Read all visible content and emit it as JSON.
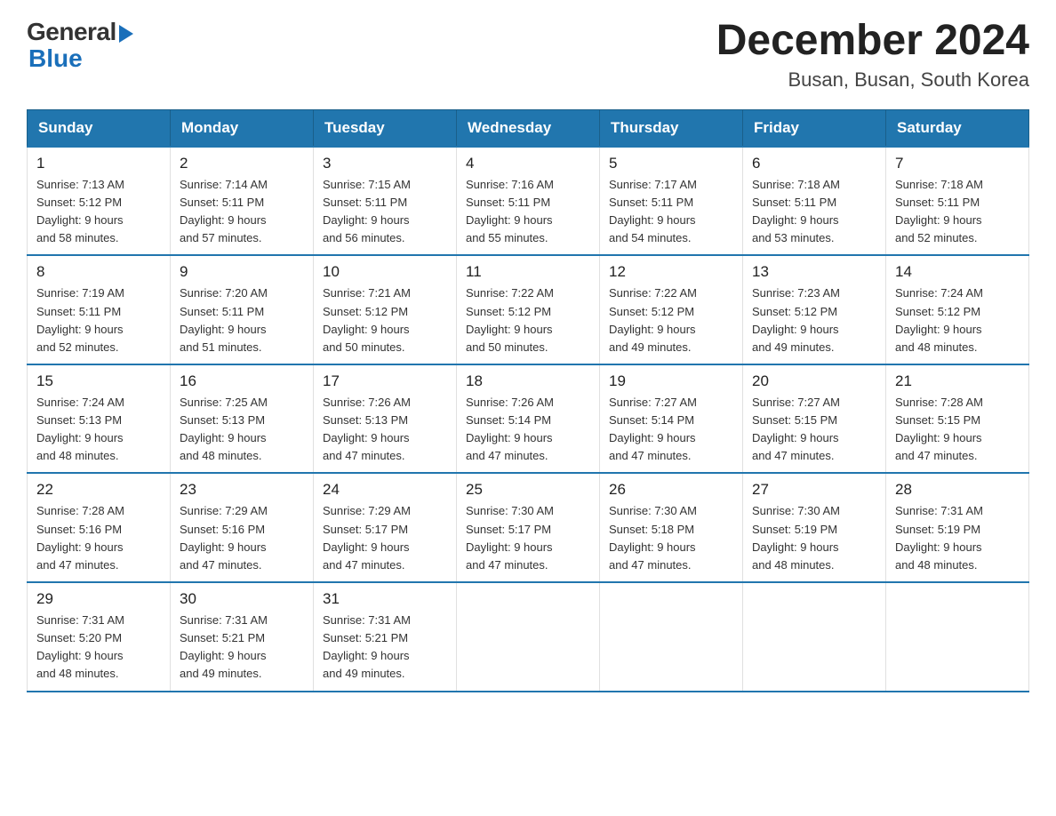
{
  "logo": {
    "general": "General",
    "blue": "Blue"
  },
  "title": {
    "month_year": "December 2024",
    "location": "Busan, Busan, South Korea"
  },
  "days_of_week": [
    "Sunday",
    "Monday",
    "Tuesday",
    "Wednesday",
    "Thursday",
    "Friday",
    "Saturday"
  ],
  "weeks": [
    [
      {
        "day": "1",
        "sunrise": "7:13 AM",
        "sunset": "5:12 PM",
        "daylight": "9 hours and 58 minutes."
      },
      {
        "day": "2",
        "sunrise": "7:14 AM",
        "sunset": "5:11 PM",
        "daylight": "9 hours and 57 minutes."
      },
      {
        "day": "3",
        "sunrise": "7:15 AM",
        "sunset": "5:11 PM",
        "daylight": "9 hours and 56 minutes."
      },
      {
        "day": "4",
        "sunrise": "7:16 AM",
        "sunset": "5:11 PM",
        "daylight": "9 hours and 55 minutes."
      },
      {
        "day": "5",
        "sunrise": "7:17 AM",
        "sunset": "5:11 PM",
        "daylight": "9 hours and 54 minutes."
      },
      {
        "day": "6",
        "sunrise": "7:18 AM",
        "sunset": "5:11 PM",
        "daylight": "9 hours and 53 minutes."
      },
      {
        "day": "7",
        "sunrise": "7:18 AM",
        "sunset": "5:11 PM",
        "daylight": "9 hours and 52 minutes."
      }
    ],
    [
      {
        "day": "8",
        "sunrise": "7:19 AM",
        "sunset": "5:11 PM",
        "daylight": "9 hours and 52 minutes."
      },
      {
        "day": "9",
        "sunrise": "7:20 AM",
        "sunset": "5:11 PM",
        "daylight": "9 hours and 51 minutes."
      },
      {
        "day": "10",
        "sunrise": "7:21 AM",
        "sunset": "5:12 PM",
        "daylight": "9 hours and 50 minutes."
      },
      {
        "day": "11",
        "sunrise": "7:22 AM",
        "sunset": "5:12 PM",
        "daylight": "9 hours and 50 minutes."
      },
      {
        "day": "12",
        "sunrise": "7:22 AM",
        "sunset": "5:12 PM",
        "daylight": "9 hours and 49 minutes."
      },
      {
        "day": "13",
        "sunrise": "7:23 AM",
        "sunset": "5:12 PM",
        "daylight": "9 hours and 49 minutes."
      },
      {
        "day": "14",
        "sunrise": "7:24 AM",
        "sunset": "5:12 PM",
        "daylight": "9 hours and 48 minutes."
      }
    ],
    [
      {
        "day": "15",
        "sunrise": "7:24 AM",
        "sunset": "5:13 PM",
        "daylight": "9 hours and 48 minutes."
      },
      {
        "day": "16",
        "sunrise": "7:25 AM",
        "sunset": "5:13 PM",
        "daylight": "9 hours and 48 minutes."
      },
      {
        "day": "17",
        "sunrise": "7:26 AM",
        "sunset": "5:13 PM",
        "daylight": "9 hours and 47 minutes."
      },
      {
        "day": "18",
        "sunrise": "7:26 AM",
        "sunset": "5:14 PM",
        "daylight": "9 hours and 47 minutes."
      },
      {
        "day": "19",
        "sunrise": "7:27 AM",
        "sunset": "5:14 PM",
        "daylight": "9 hours and 47 minutes."
      },
      {
        "day": "20",
        "sunrise": "7:27 AM",
        "sunset": "5:15 PM",
        "daylight": "9 hours and 47 minutes."
      },
      {
        "day": "21",
        "sunrise": "7:28 AM",
        "sunset": "5:15 PM",
        "daylight": "9 hours and 47 minutes."
      }
    ],
    [
      {
        "day": "22",
        "sunrise": "7:28 AM",
        "sunset": "5:16 PM",
        "daylight": "9 hours and 47 minutes."
      },
      {
        "day": "23",
        "sunrise": "7:29 AM",
        "sunset": "5:16 PM",
        "daylight": "9 hours and 47 minutes."
      },
      {
        "day": "24",
        "sunrise": "7:29 AM",
        "sunset": "5:17 PM",
        "daylight": "9 hours and 47 minutes."
      },
      {
        "day": "25",
        "sunrise": "7:30 AM",
        "sunset": "5:17 PM",
        "daylight": "9 hours and 47 minutes."
      },
      {
        "day": "26",
        "sunrise": "7:30 AM",
        "sunset": "5:18 PM",
        "daylight": "9 hours and 47 minutes."
      },
      {
        "day": "27",
        "sunrise": "7:30 AM",
        "sunset": "5:19 PM",
        "daylight": "9 hours and 48 minutes."
      },
      {
        "day": "28",
        "sunrise": "7:31 AM",
        "sunset": "5:19 PM",
        "daylight": "9 hours and 48 minutes."
      }
    ],
    [
      {
        "day": "29",
        "sunrise": "7:31 AM",
        "sunset": "5:20 PM",
        "daylight": "9 hours and 48 minutes."
      },
      {
        "day": "30",
        "sunrise": "7:31 AM",
        "sunset": "5:21 PM",
        "daylight": "9 hours and 49 minutes."
      },
      {
        "day": "31",
        "sunrise": "7:31 AM",
        "sunset": "5:21 PM",
        "daylight": "9 hours and 49 minutes."
      },
      null,
      null,
      null,
      null
    ]
  ],
  "labels": {
    "sunrise": "Sunrise:",
    "sunset": "Sunset:",
    "daylight": "Daylight:"
  }
}
